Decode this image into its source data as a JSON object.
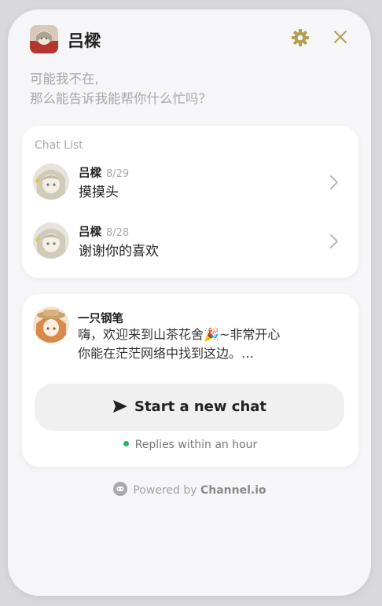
{
  "header": {
    "title": "吕樑",
    "intro_line1": "可能我不在,",
    "intro_line2": "那么能告诉我能帮你什么忙吗？"
  },
  "chat_list": {
    "label": "Chat List",
    "items": [
      {
        "name": "吕樑",
        "date": "8/29",
        "message": "摸摸头"
      },
      {
        "name": "吕樑",
        "date": "8/28",
        "message": "谢谢你的喜欢"
      }
    ]
  },
  "welcome": {
    "name": "一只钢笔",
    "message_line1": "嗨，欢迎来到山茶花舍🎉~非常开心",
    "message_line2": "你能在茫茫网络中找到这边。…"
  },
  "cta": {
    "label": "Start a new chat"
  },
  "reply_time": "Replies within an hour",
  "footer": {
    "powered_by": "Powered by",
    "brand": "Channel.io"
  },
  "colors": {
    "accent": "#b4a050",
    "status_online": "#2bb161"
  }
}
